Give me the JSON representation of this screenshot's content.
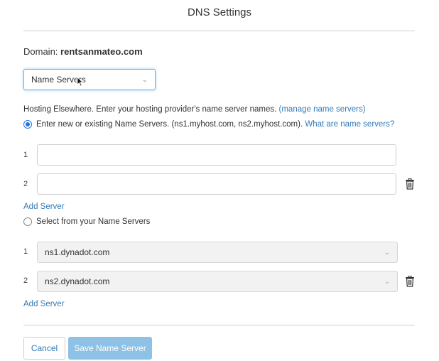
{
  "dialog": {
    "title": "DNS Settings",
    "domain_label": "Domain:",
    "domain_value": "rentsanmateo.com"
  },
  "mode_select": {
    "selected": "Name Servers",
    "icon": "chevron-down-icon"
  },
  "hosting": {
    "description": "Hosting Elsewhere. Enter your hosting provider's name server names.",
    "manage_link": "(manage name servers)"
  },
  "option_new": {
    "checked": true,
    "label": "Enter new or existing Name Servers. (ns1.myhost.com, ns2.myhost.com).",
    "help_link": "What are name servers?",
    "rows": [
      {
        "num": "1",
        "value": ""
      },
      {
        "num": "2",
        "value": ""
      }
    ],
    "add_label": "Add Server"
  },
  "option_existing": {
    "checked": false,
    "label": "Select from your Name Servers",
    "rows": [
      {
        "num": "1",
        "value": "ns1.dynadot.com"
      },
      {
        "num": "2",
        "value": "ns2.dynadot.com"
      }
    ],
    "add_label": "Add Server"
  },
  "footer": {
    "cancel_label": "Cancel",
    "save_label": "Save Name Server"
  },
  "colors": {
    "link": "#337ab7",
    "radio_accent": "#1a73e8",
    "save_button_bg": "#8ec1e6"
  }
}
